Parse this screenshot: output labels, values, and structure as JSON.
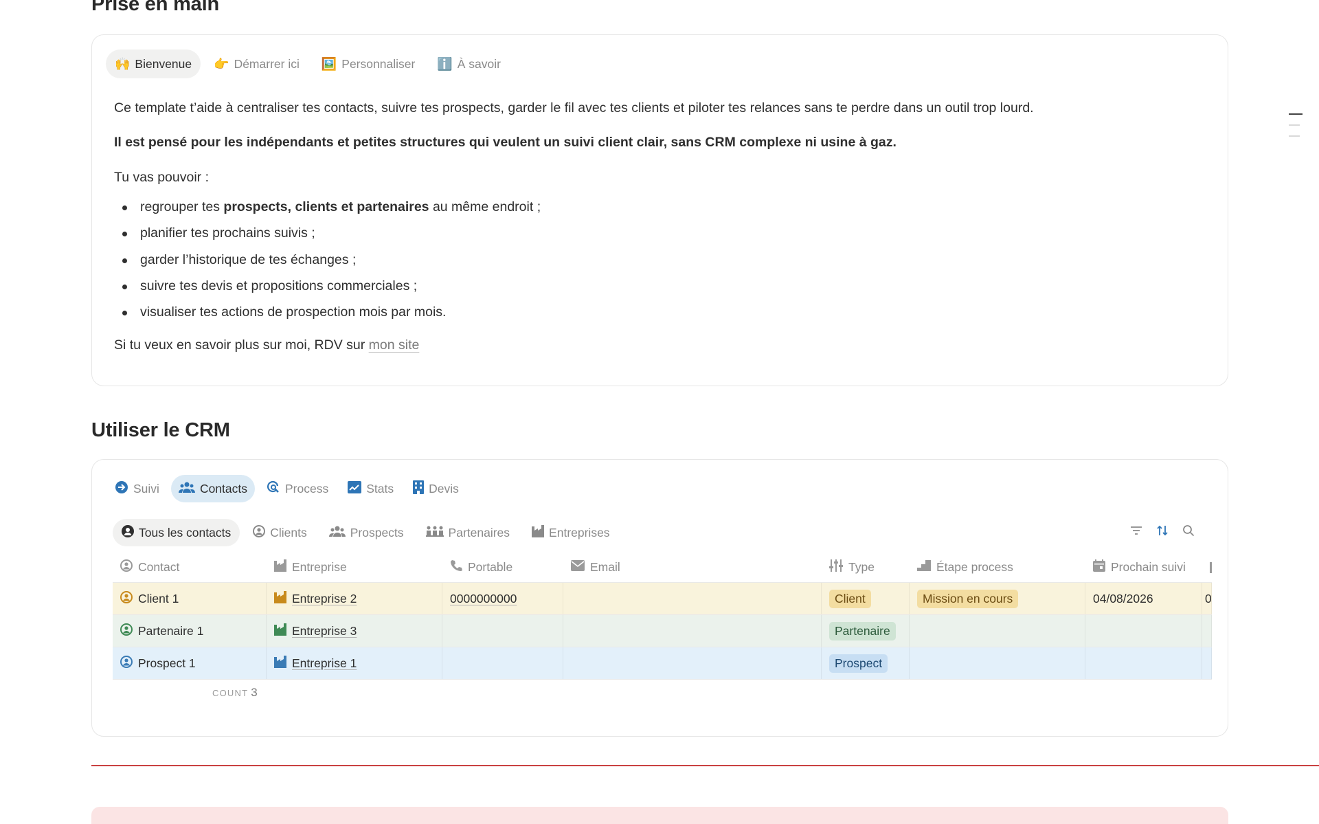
{
  "section1": {
    "title": "Prise en main",
    "tabs": [
      {
        "emoji": "🙌",
        "label": "Bienvenue"
      },
      {
        "emoji": "👉",
        "label": "Démarrer ici"
      },
      {
        "emoji": "🖼️",
        "label": "Personnaliser"
      },
      {
        "emoji": "ℹ️",
        "label": "À savoir"
      }
    ],
    "intro": "Ce template t’aide à centraliser tes contacts, suivre tes prospects, garder le fil avec tes clients et piloter tes relances sans te perdre dans un outil trop lourd.",
    "bold_line": "Il est pensé pour les indépendants et petites structures qui veulent un suivi client clair, sans CRM complexe ni usine à gaz.",
    "lead": "Tu vas pouvoir :",
    "bullet1_pre": "regrouper tes ",
    "bullet1_bold": "prospects, clients et partenaires",
    "bullet1_post": " au même endroit ;",
    "bullets": [
      "planifier tes prochains suivis ;",
      "garder l’historique de tes échanges ;",
      "suivre tes devis et propositions commerciales ;",
      "visualiser tes actions de prospection mois par mois."
    ],
    "footer_pre": "Si tu veux en savoir plus sur moi, RDV sur ",
    "footer_link": "mon site"
  },
  "section2": {
    "title": "Utiliser le CRM",
    "tabs": [
      {
        "label": "Suivi",
        "icon": "arrow-circle-icon"
      },
      {
        "label": "Contacts",
        "icon": "people-icon"
      },
      {
        "label": "Process",
        "icon": "refresh-search-icon"
      },
      {
        "label": "Stats",
        "icon": "chart-icon"
      },
      {
        "label": "Devis",
        "icon": "building-icon"
      }
    ],
    "views": [
      "Tous les contacts",
      "Clients",
      "Prospects",
      "Partenaires",
      "Entreprises"
    ],
    "columns": [
      "Contact",
      "Entreprise",
      "Portable",
      "Email",
      "Type",
      "Étape process",
      "Prochain suivi"
    ],
    "rows": [
      {
        "contact": "Client 1",
        "entreprise": "Entreprise 2",
        "portable": "0000000000",
        "email": "",
        "type": "Client",
        "etape": "Mission en cours",
        "suivi": "04/08/2026",
        "extra": "0"
      },
      {
        "contact": "Partenaire 1",
        "entreprise": "Entreprise 3",
        "portable": "",
        "email": "",
        "type": "Partenaire",
        "etape": "",
        "suivi": "",
        "extra": ""
      },
      {
        "contact": "Prospect 1",
        "entreprise": "Entreprise 1",
        "portable": "",
        "email": "",
        "type": "Prospect",
        "etape": "",
        "suivi": "",
        "extra": ""
      }
    ],
    "count_label": "COUNT",
    "count_value": "3"
  },
  "colors": {
    "client": "#c88a1c",
    "partenaire": "#3f8a55",
    "prospect": "#3a7bb5",
    "accent_blue": "#2e75b6",
    "divider": "#c94141"
  }
}
